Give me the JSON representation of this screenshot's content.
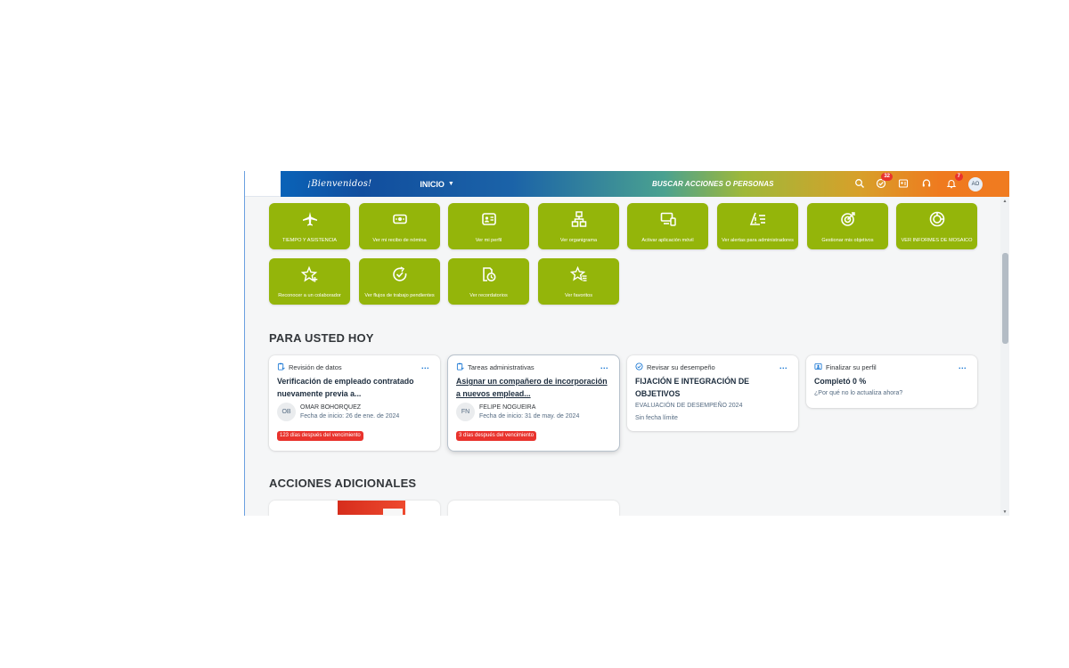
{
  "header": {
    "logo_text": "¡Bienvenidos!",
    "nav_label": "INICIO",
    "search_label": "BUSCAR ACCIONES O PERSONAS",
    "badges": {
      "approvals": "32",
      "notifications": "7"
    },
    "avatar_initials": "AO",
    "icons": [
      "search-icon",
      "approvals-icon",
      "people-icon",
      "headset-icon",
      "bell-icon"
    ]
  },
  "tiles": [
    {
      "label": "TIEMPO Y ASISTENCIA",
      "icon": "airplane-icon"
    },
    {
      "label": "Ver mi recibo de nómina",
      "icon": "money-icon"
    },
    {
      "label": "Ver mi perfil",
      "icon": "id-card-icon"
    },
    {
      "label": "Ver organigrama",
      "icon": "org-chart-icon"
    },
    {
      "label": "Activar aplicación móvil",
      "icon": "devices-icon"
    },
    {
      "label": "Ver alertas para administradores",
      "icon": "alert-icon"
    },
    {
      "label": "Gestionar mis objetivos",
      "icon": "target-icon"
    },
    {
      "label": "VER INFORMES DE MOSAICO",
      "icon": "report-icon"
    },
    {
      "label": "Reconocer a un colaborador",
      "icon": "star-plus-icon"
    },
    {
      "label": "Ver flujos de trabajo pendientes",
      "icon": "refresh-check-icon"
    },
    {
      "label": "Ver recordatorios",
      "icon": "reminder-icon"
    },
    {
      "label": "Ver favoritos",
      "icon": "favorite-list-icon"
    }
  ],
  "sections": {
    "today_title": "PARA USTED HOY",
    "additional_title": "ACCIONES ADICIONALES"
  },
  "cards": [
    {
      "category": "Revisión de datos",
      "title": "Verificación de empleado contratado nuevamente previa a...",
      "person_initials": "OB",
      "person_name": "OMAR BOHORQUEZ",
      "person_date": "Fecha de inicio: 26 de ene. de 2024",
      "due": "123 días después del vencimiento",
      "more": "..."
    },
    {
      "category": "Tareas administrativas",
      "title": "Asignar un compañero de incorporación a nuevos emplead...",
      "person_initials": "FN",
      "person_name": "FELIPE NOGUEIRA",
      "person_date": "Fecha de inicio: 31 de may. de 2024",
      "due": "3 días después del vencimiento",
      "more": "..."
    },
    {
      "category": "Revisar su desempeño",
      "title": "FIJACIÓN E INTEGRACIÓN DE OBJETIVOS",
      "sub1": "EVALUACIÓN DE DESEMPEÑO 2024",
      "sub2": "Sin fecha límite",
      "more": "..."
    },
    {
      "category": "Finalizar su perfil",
      "title": "Completó 0 %",
      "sub1": "¿Por qué no lo actualiza ahora?",
      "more": "..."
    }
  ]
}
